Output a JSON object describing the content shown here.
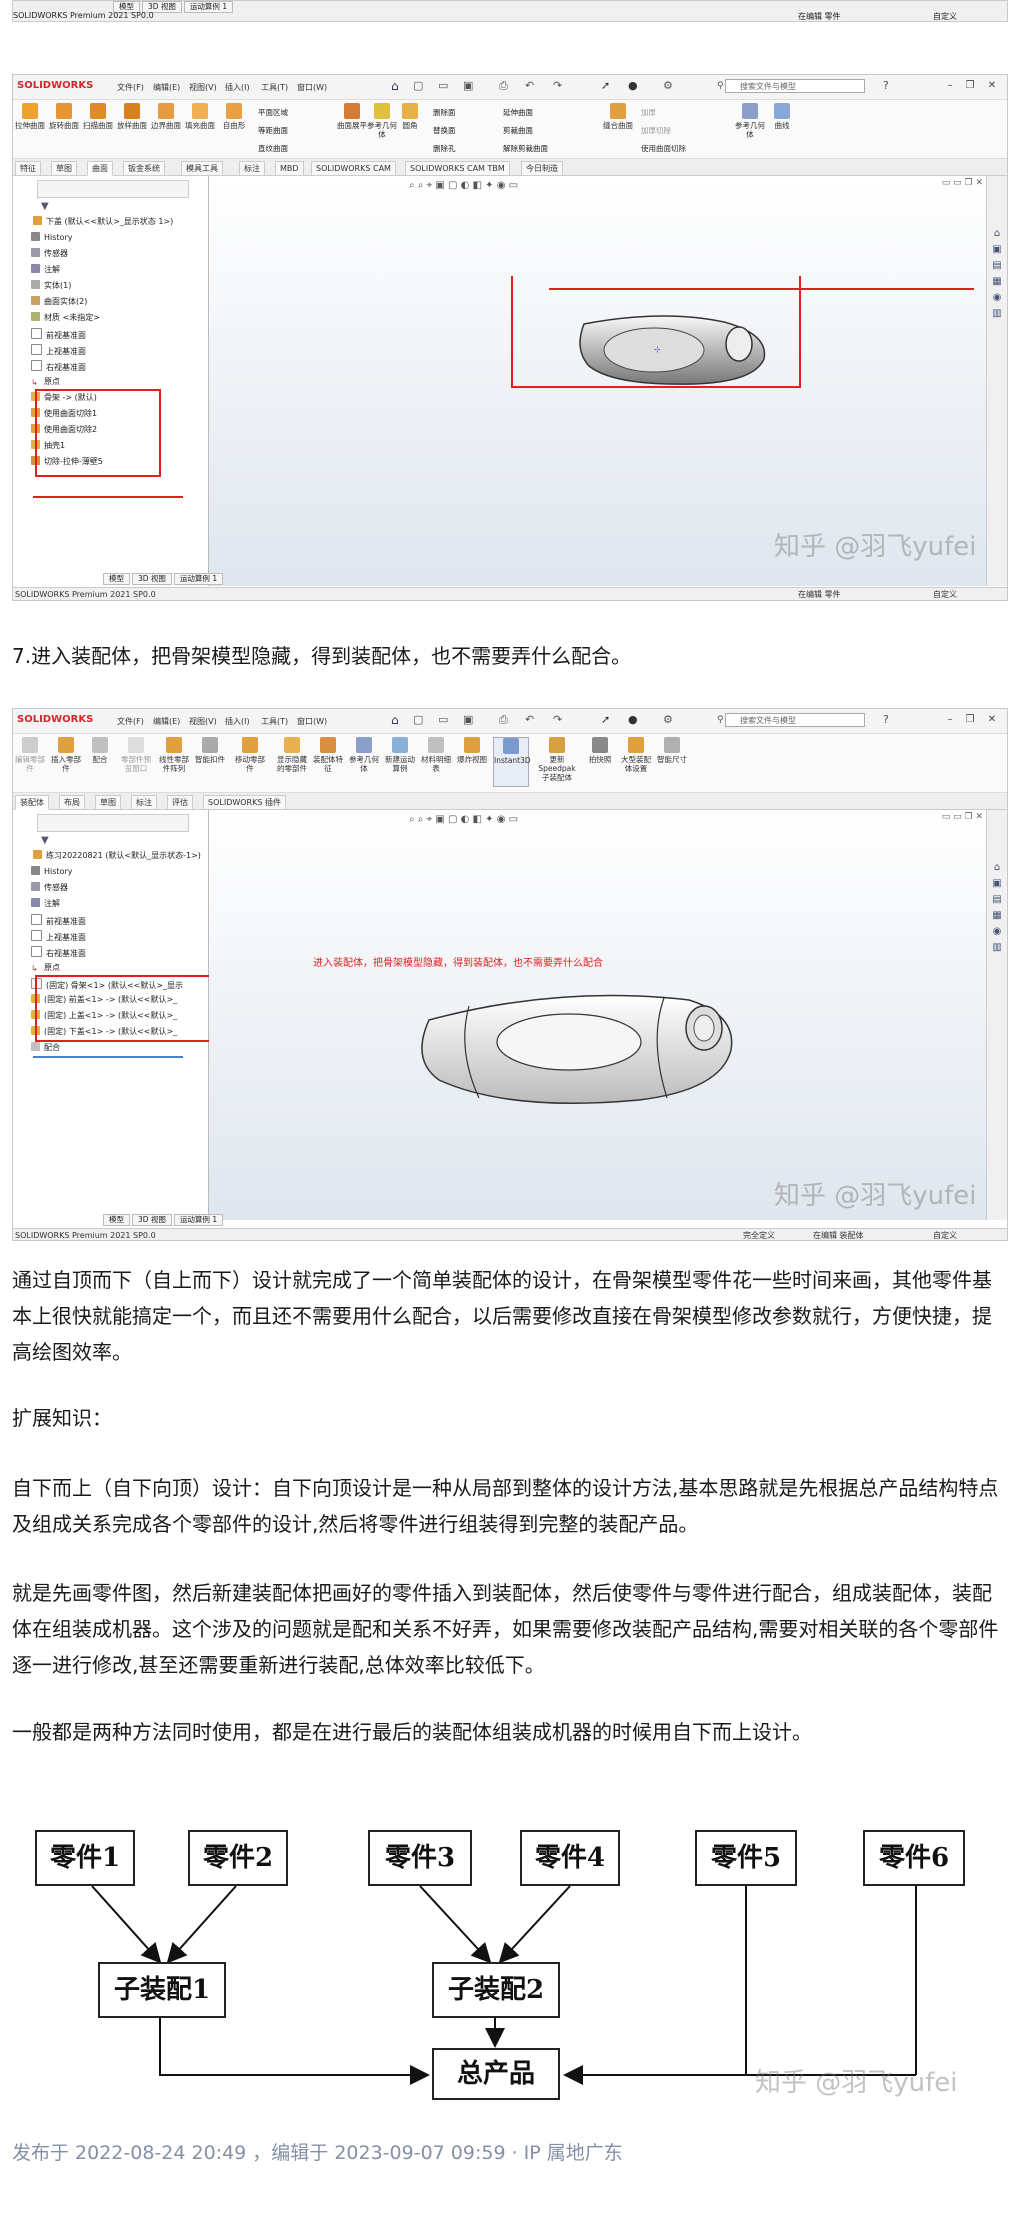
{
  "top_strip": {
    "status_left": "SOLIDWORKS Premium 2021 SP0.0",
    "status_mid": "在编辑 零件",
    "status_right": "自定义",
    "bottom_tabs": [
      "模型",
      "3D 视图",
      "运动算例 1"
    ]
  },
  "screenshot1": {
    "app_logo": "SOLIDWORKS",
    "menus": [
      "文件(F)",
      "编辑(E)",
      "视图(V)",
      "插入(I)",
      "工具(T)",
      "窗口(W)"
    ],
    "search_placeholder": "搜索文件与模型",
    "ribbon_tools": [
      "拉伸曲面",
      "旋转曲面",
      "扫描曲面",
      "放样曲面",
      "边界曲面",
      "填充曲面",
      "自由形"
    ],
    "ribbon_tools_right": [
      "平面区域",
      "等距曲面",
      "直纹曲面",
      "曲面展平",
      "参考几何体",
      "圆角",
      "删除面",
      "替换面",
      "删除孔",
      "延伸曲面",
      "剪裁曲面",
      "解除剪裁曲面",
      "缝合曲面",
      "加厚",
      "加厚切除",
      "使用曲面切除",
      "参考几何体",
      "曲线"
    ],
    "tabs": [
      "特征",
      "草图",
      "曲面",
      "钣金系统",
      "模具工具",
      "标注",
      "MBD",
      "SOLIDWORKS CAM",
      "SOLIDWORKS CAM TBM",
      "今日制造"
    ],
    "active_tab": "曲面",
    "tree_root": "下盖 (默认<<默认>_显示状态 1>)",
    "tree": [
      "History",
      "传感器",
      "注解",
      "实体(1)",
      "曲面实体(2)",
      "材质 <未指定>",
      "前视基准面",
      "上视基准面",
      "右视基准面",
      "原点",
      "骨架 -> (默认)",
      "使用曲面切除1",
      "使用曲面切除2",
      "抽壳1",
      "切除-拉伸-薄壁5"
    ],
    "status_left": "SOLIDWORKS Premium 2021 SP0.0",
    "status_mid": "在编辑 零件",
    "status_right": "自定义",
    "bottom_tabs": [
      "模型",
      "3D 视图",
      "运动算例 1"
    ],
    "watermark": "知乎 @羽飞yufei"
  },
  "paragraph_step7": "7.进入装配体，把骨架模型隐藏，得到装配体，也不需要弄什么配合。",
  "screenshot2": {
    "app_logo": "SOLIDWORKS",
    "menus": [
      "文件(F)",
      "编辑(E)",
      "视图(V)",
      "插入(I)",
      "工具(T)",
      "窗口(W)"
    ],
    "search_placeholder": "搜索文件与模型",
    "ribbon_tools": [
      "编辑零部件",
      "插入零部件",
      "配合",
      "零部件预览窗口",
      "线性零部件阵列",
      "智能扣件",
      "移动零部件",
      "显示隐藏的零部件",
      "装配体特征",
      "参考几何体",
      "新建运动算例",
      "材料明细表",
      "爆炸视图",
      "Instant3D",
      "更新Speedpak子装配体",
      "拍快照",
      "大型装配体设置",
      "智能尺寸"
    ],
    "tabs": [
      "装配体",
      "布局",
      "草图",
      "标注",
      "评估",
      "SOLIDWORKS 插件"
    ],
    "active_tab": "装配体",
    "tree_root": "练习20220821 (默认<默认_显示状态-1>)",
    "tree": [
      "History",
      "传感器",
      "注解",
      "前视基准面",
      "上视基准面",
      "右视基准面",
      "原点",
      "(固定) 骨架<1> (默认<<默认>_显示",
      "(固定) 前盖<1> -> (默认<<默认>_",
      "(固定) 上盖<1> -> (默认<<默认>_",
      "(固定) 下盖<1> -> (默认<<默认>_",
      "配合"
    ],
    "annotation": "进入装配体，把骨架模型隐藏，得到装配体，也不需要弄什么配合",
    "status_left": "SOLIDWORKS Premium 2021 SP0.0",
    "status_mid": "完全定义",
    "status_mid2": "在编辑 装配体",
    "status_right": "自定义",
    "bottom_tabs": [
      "模型",
      "3D 视图",
      "运动算例 1"
    ],
    "watermark": "知乎 @羽飞yufei"
  },
  "paragraph_summary": "通过自顶而下（自上而下）设计就完成了一个简单装配体的设计，在骨架模型零件花一些时间来画，其他零件基本上很快就能搞定一个，而且还不需要用什么配合，以后需要修改直接在骨架模型修改参数就行，方便快捷，提高绘图效率。",
  "paragraph_ext": "扩展知识：",
  "paragraph_bottom_up": "自下而上（自下向顶）设计：自下向顶设计是一种从局部到整体的设计方法,基本思路就是先根据总产品结构特点及组成关系完成各个零部件的设计,然后将零件进行组装得到完整的装配产品。",
  "paragraph_detail": "就是先画零件图，然后新建装配体把画好的零件插入到装配体，然后使零件与零件进行配合，组成装配体，装配体在组装成机器。这个涉及的问题就是配和关系不好弄，如果需要修改装配产品结构,需要对相关联的各个零部件逐一进行修改,甚至还需要重新进行装配,总体效率比较低下。",
  "paragraph_both": "一般都是两种方法同时使用，都是在进行最后的装配体组装成机器的时候用自下而上设计。",
  "diagram": {
    "parts": [
      "零件1",
      "零件2",
      "零件3",
      "零件4",
      "零件5",
      "零件6"
    ],
    "subassemblies": [
      "子装配1",
      "子装配2"
    ],
    "product": "总产品",
    "watermark": "知乎 @羽飞yufei"
  },
  "footer_meta": "发布于 2022-08-24 20:49 ，编辑于 2023-09-07 09:59 · IP 属地广东"
}
